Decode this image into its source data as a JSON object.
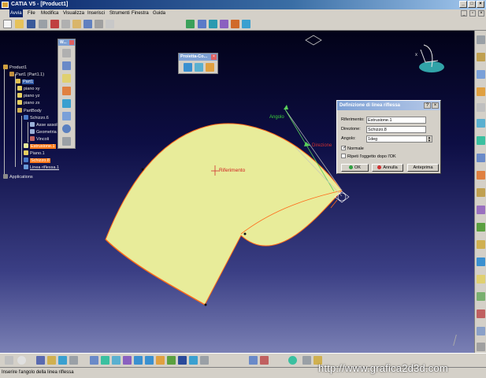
{
  "window": {
    "title": "CATIA V5 - [Product1]"
  },
  "menu": {
    "items": [
      "Avvia",
      "File",
      "Modifica",
      "Visualizza",
      "Inserisci",
      "Strumenti",
      "Finestra",
      "Guida"
    ]
  },
  "tree": {
    "nodes": [
      {
        "label": "Product1"
      },
      {
        "label": "Part1 (Part1.1)"
      },
      {
        "label": "Part1"
      },
      {
        "label": "piano xy"
      },
      {
        "label": "piano yz"
      },
      {
        "label": "piano zx"
      },
      {
        "label": "PartBody"
      },
      {
        "label": "Schizzo.6"
      },
      {
        "label": "Asse assolut"
      },
      {
        "label": "Geometria"
      },
      {
        "label": "Vincoli"
      },
      {
        "label": "Estrusione.1"
      },
      {
        "label": "Piano.1"
      },
      {
        "label": "Schizzo.8"
      },
      {
        "label": "Linea riflessa.1"
      },
      {
        "label": "Applications"
      }
    ]
  },
  "floating_toolbar": {
    "title": "W..."
  },
  "project_toolbar": {
    "title": "Proietta-Co..."
  },
  "viewport": {
    "label_riferimento": "Riferimento",
    "label_angolo": "Angolo",
    "label_direzione": "Direzione"
  },
  "dialog": {
    "title": "Definizione di linea riflessa",
    "riferimento_label": "Riferimento:",
    "riferimento_value": "Estrusione.1",
    "direzione_label": "Direzione:",
    "direzione_value": "Schizzo.8",
    "angolo_label": "Angolo:",
    "angolo_value": "1deg",
    "normale_label": "Normale",
    "ripeti_label": "Ripeti l'oggetto dopo l'OK",
    "ok_label": "OK",
    "annulla_label": "Annulla",
    "anteprima_label": "Anteprima"
  },
  "statusbar": {
    "text": "Inserire l'angolo della linea riflessa"
  },
  "watermark": {
    "text": "http://www.grafica2d3d.com"
  },
  "colors": {
    "surface": "#e8ec9a",
    "edge": "#ff6a1a",
    "highlight": "#ff7a1a",
    "selection": "#2f5aa8"
  }
}
